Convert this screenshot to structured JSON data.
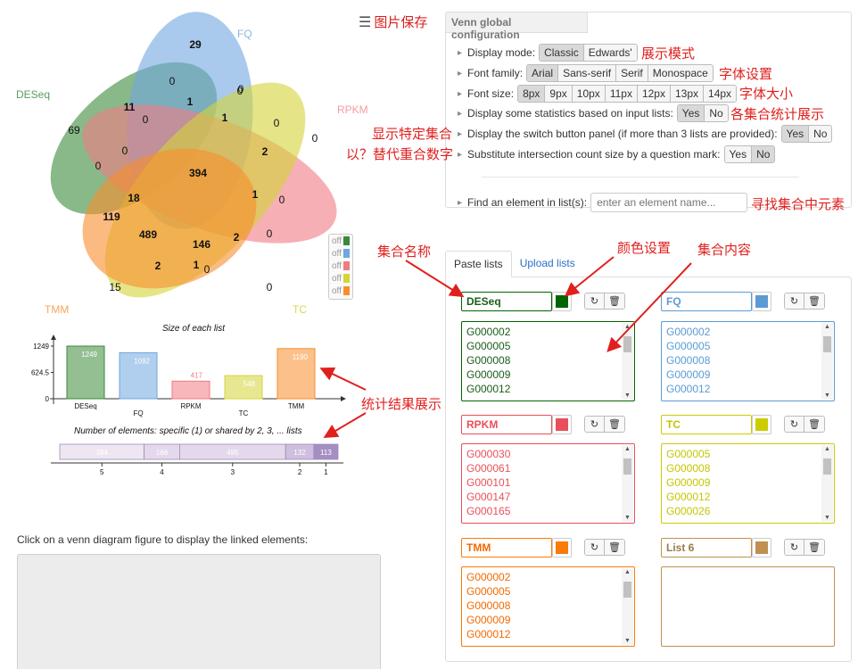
{
  "venn": {
    "set_labels": [
      "DESeq",
      "FQ",
      "RPKM",
      "TC",
      "TMM"
    ],
    "set_colors": [
      "#3a8a3a",
      "#6fa6df",
      "#f07b83",
      "#d4d437",
      "#f98d2c"
    ],
    "numbers": [
      "29",
      "0",
      "0",
      "11",
      "1",
      "0",
      "69",
      "0",
      "1",
      "0",
      "0",
      "2",
      "0",
      "394",
      "0",
      "18",
      "1",
      "0",
      "119",
      "489",
      "146",
      "2",
      "0",
      "2",
      "1",
      "0",
      "15",
      "0"
    ],
    "toggle_label": "off"
  },
  "save": {
    "label": "图片保存"
  },
  "bar_chart": {
    "title": "Size of each list",
    "y_ticks": [
      "1249",
      "624.5",
      "0"
    ]
  },
  "share_chart": {
    "title": "Number of elements: specific (1) or shared by 2, 3, ... lists"
  },
  "chart_data": [
    {
      "type": "bar",
      "title": "Size of each list",
      "categories": [
        "DESeq",
        "FQ",
        "RPKM",
        "TC",
        "TMM"
      ],
      "values": [
        1249,
        1092,
        417,
        548,
        1190
      ],
      "colors": [
        "#3a8a3a",
        "#6fa6df",
        "#f07b83",
        "#d4d437",
        "#f98d2c"
      ],
      "ylim": [
        0,
        1249
      ]
    },
    {
      "type": "bar",
      "title": "Number of elements: specific (1) or shared by 2, 3, ... lists",
      "categories": [
        "5",
        "4",
        "3",
        "2",
        "1"
      ],
      "values": [
        394,
        166,
        495,
        132,
        113
      ]
    }
  ],
  "linked": {
    "text": "Click on a venn diagram figure to display the linked elements:"
  },
  "config": {
    "tab": "Venn global configuration",
    "display_mode": {
      "label": "Display mode:",
      "options": [
        "Classic",
        "Edwards'"
      ],
      "selected": "Classic"
    },
    "font_family": {
      "label": "Font family:",
      "options": [
        "Arial",
        "Sans-serif",
        "Serif",
        "Monospace"
      ],
      "selected": "Arial"
    },
    "font_size": {
      "label": "Font size:",
      "options": [
        "8px",
        "9px",
        "10px",
        "11px",
        "12px",
        "13px",
        "14px"
      ],
      "selected": "8px"
    },
    "statistics": {
      "label": "Display some statistics based on input lists:",
      "yes": "Yes",
      "no": "No"
    },
    "switch_panel": {
      "label": "Display the switch button panel (if more than 3 lists are provided):",
      "yes": "Yes",
      "no": "No"
    },
    "substitute": {
      "label": "Substitute intersection count size by a question mark:",
      "yes": "Yes",
      "no": "No"
    },
    "find": {
      "label": "Find an element in list(s):",
      "placeholder": "enter an element name..."
    }
  },
  "tabs": {
    "paste": "Paste lists",
    "upload": "Upload lists"
  },
  "lists": [
    {
      "name": "DESeq",
      "color": "#006400",
      "text_color": "#1a5e1a",
      "items": [
        "G000002",
        "G000005",
        "G000008",
        "G000009",
        "G000012"
      ]
    },
    {
      "name": "FQ",
      "color": "#5b9bd5",
      "text_color": "#5b9bd5",
      "items": [
        "G000002",
        "G000005",
        "G000008",
        "G000009",
        "G000012"
      ]
    },
    {
      "name": "RPKM",
      "color": "#e8505b",
      "text_color": "#e8505b",
      "items": [
        "G000030",
        "G000061",
        "G000101",
        "G000147",
        "G000165"
      ]
    },
    {
      "name": "TC",
      "color": "#cccc00",
      "text_color": "#c5c500",
      "items": [
        "G000005",
        "G000008",
        "G000009",
        "G000012",
        "G000026"
      ]
    },
    {
      "name": "TMM",
      "color": "#f97b08",
      "text_color": "#f26a00",
      "items": [
        "G000002",
        "G000005",
        "G000008",
        "G000009",
        "G000012"
      ]
    },
    {
      "name": "List 6",
      "color": "#c09050",
      "text_color": "#9a7a4a",
      "items": []
    }
  ],
  "annotations": {
    "display_mode": "展示模式",
    "font_setting": "字体设置",
    "font_size": "字体大小",
    "statistics": "各集合统计展示",
    "show_specific": "显示特定集合",
    "substitute": "以？替代重合数字",
    "find": "寻找集合中元素",
    "set_name": "集合名称",
    "color_setting": "颜色设置",
    "set_content": "集合内容",
    "stats_result": "统计结果展示"
  }
}
